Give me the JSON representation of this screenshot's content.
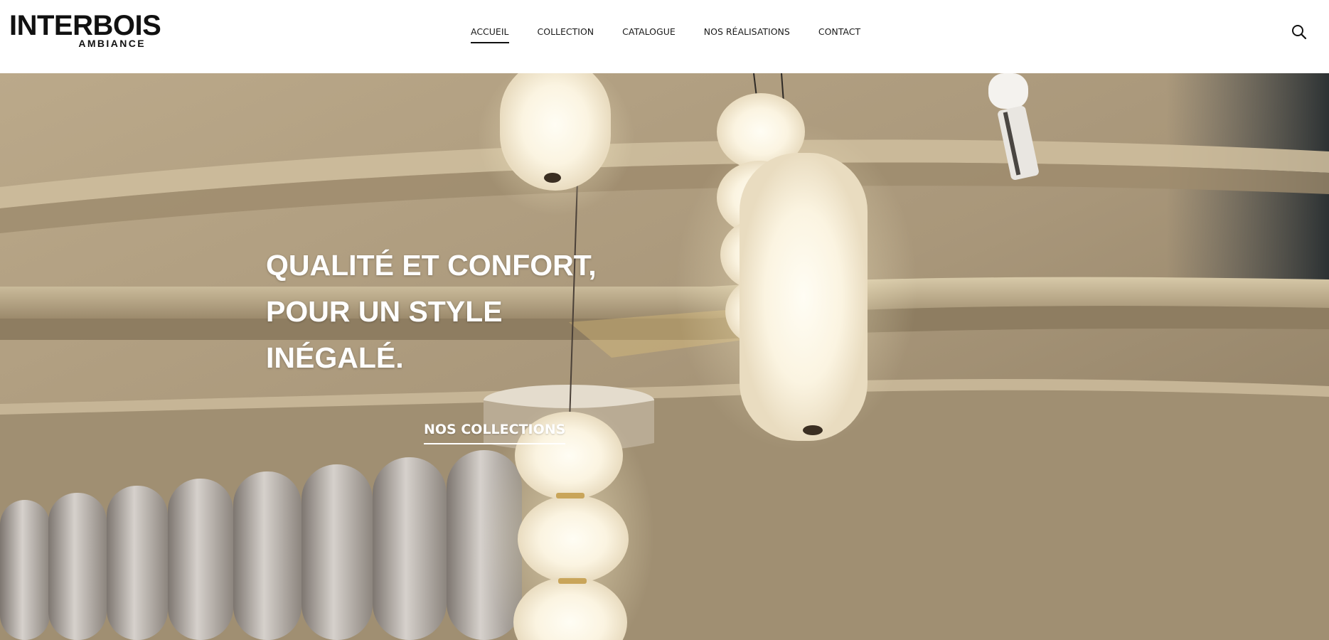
{
  "header": {
    "logo": {
      "main": "INTERBOIS",
      "sub": "AMBIANCE"
    },
    "nav": [
      {
        "label": "ACCUEIL",
        "active": true
      },
      {
        "label": "COLLECTION",
        "active": false
      },
      {
        "label": "CATALOGUE",
        "active": false
      },
      {
        "label": "NOS RÉALISATIONS",
        "active": false
      },
      {
        "label": "CONTACT",
        "active": false
      }
    ],
    "search_icon": "search-icon"
  },
  "hero": {
    "headline": [
      "QUALITÉ ET CONFORT,",
      "POUR UN STYLE",
      "INÉGALÉ."
    ],
    "cta_label": "NOS COLLECTIONS",
    "image_subject": "pendant-lamps-photo"
  },
  "colors": {
    "header_bg": "#ffffff",
    "text_dark": "#111111",
    "hero_text": "#ffffff",
    "hero_wall": "#a89677"
  }
}
